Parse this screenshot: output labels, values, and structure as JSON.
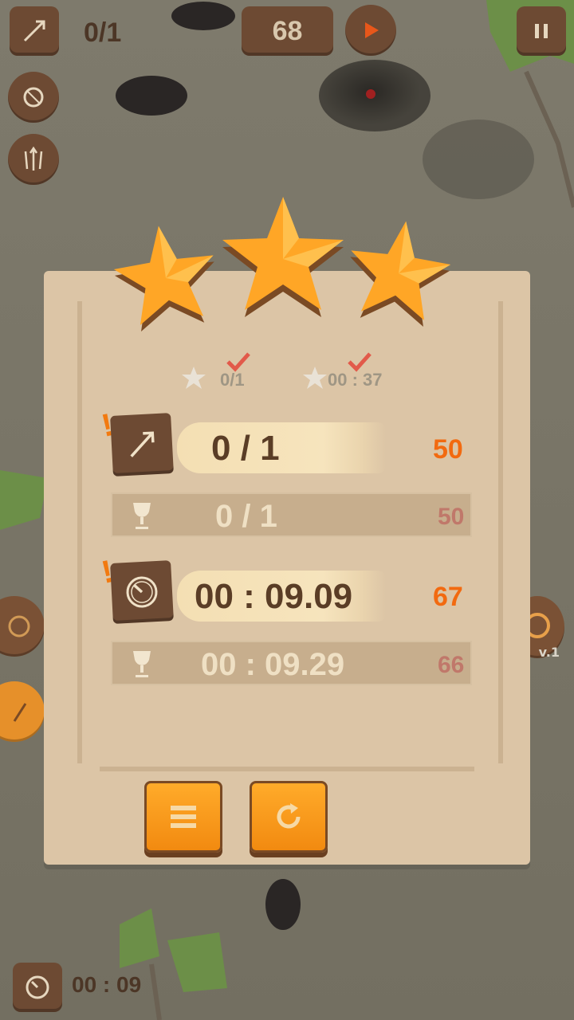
{
  "hud": {
    "arrow_count": "0/1",
    "score": "68",
    "bottom_timer": "00 : 09",
    "level_label": "v.1"
  },
  "result": {
    "stars_earned": 3,
    "goals": [
      {
        "value": "0/1",
        "completed": true
      },
      {
        "value": "00 : 37",
        "completed": true
      }
    ],
    "rows": [
      {
        "icon": "arrow-icon",
        "value": "0 / 1",
        "score": "50",
        "best_value": "0 / 1",
        "best_score": "50"
      },
      {
        "icon": "stopwatch-icon",
        "value": "00 : 09.09",
        "score": "67",
        "best_value": "00 : 09.29",
        "best_score": "66"
      }
    ]
  },
  "colors": {
    "panel": "#dcc5a6",
    "wood": "#6d4a33",
    "accent_orange": "#f26a10",
    "star": "#ffa626"
  }
}
